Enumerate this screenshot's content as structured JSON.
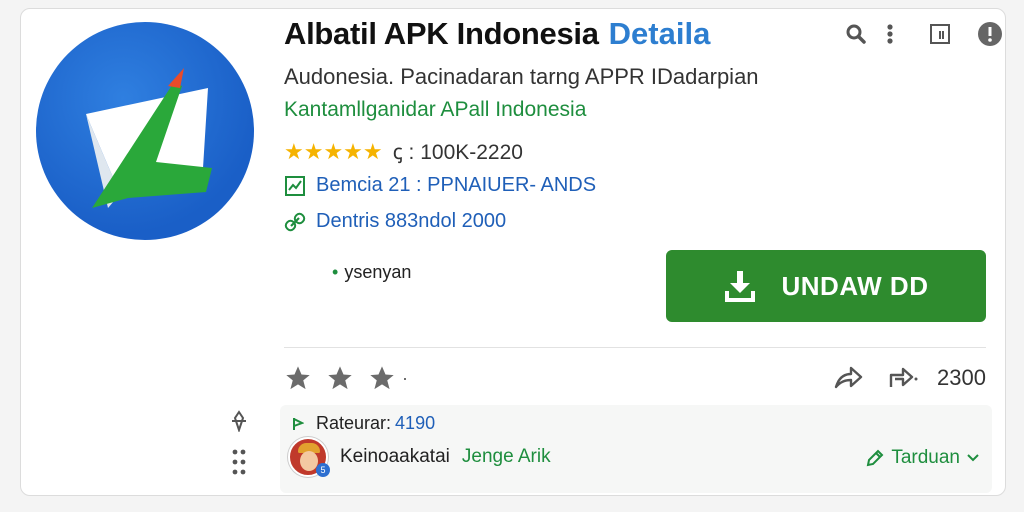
{
  "header": {
    "title": "Albatil APK Indonesia",
    "title_accent": "Detaila"
  },
  "subtitle": "Audonesia. Pacinadaran tarng APPR IDadarpian",
  "developer": "Kantamllganidar APall Indonesia",
  "rating": {
    "stars": "★★★★★",
    "value": 4.5,
    "downloads_text": "ꞔ : 100K-2220"
  },
  "meta": {
    "version": "Bemcia 21 : PPNAIUER- ANDS",
    "size": "Dentris 883ndol 2000"
  },
  "tag_label": "ysenyan",
  "install_button": {
    "label": "UNDAW DD"
  },
  "actions": {
    "count": "2300"
  },
  "comment": {
    "line1_label": "Rateurar:",
    "line1_value": "4190",
    "author": "Keinoaakatai",
    "author_highlight": "Jenge Arik",
    "translate_label": "Tarduan"
  },
  "colors": {
    "accent_green": "#2e8b2e",
    "link_blue": "#1f5fb8",
    "star_yellow": "#f5b300"
  }
}
